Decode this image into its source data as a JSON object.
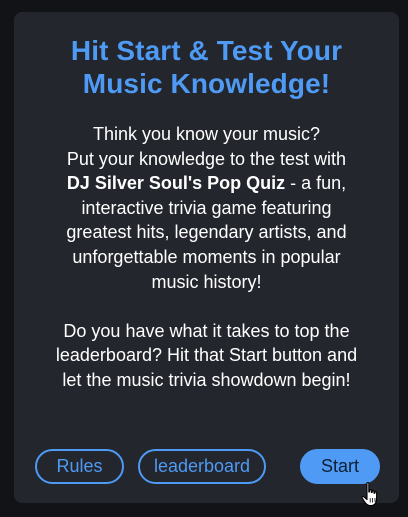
{
  "card": {
    "title_line1": "Hit Start & Test Your",
    "title_line2": "Music Knowledge!",
    "intro_line1": "Think you know your music?",
    "intro_line2": "Put your knowledge to the test with",
    "quiz_name": "DJ Silver Soul's Pop Quiz",
    "intro_line3_rest": " - a fun,",
    "intro_line4": "interactive trivia game featuring",
    "intro_line5": "greatest hits, legendary artists, and",
    "intro_line6": "unforgettable moments in popular",
    "intro_line7": "music history!",
    "cta_line1": "Do you have what it takes to top the",
    "cta_line2": "leaderboard? Hit that Start button and",
    "cta_line3": "let the music trivia showdown begin!"
  },
  "buttons": {
    "rules": "Rules",
    "leaderboard": "leaderboard",
    "start": "Start"
  },
  "colors": {
    "accent": "#4e9af4",
    "card_bg": "#23262d",
    "page_bg": "#121317"
  },
  "icons": {
    "cursor": "hand-pointer-cursor-icon"
  }
}
